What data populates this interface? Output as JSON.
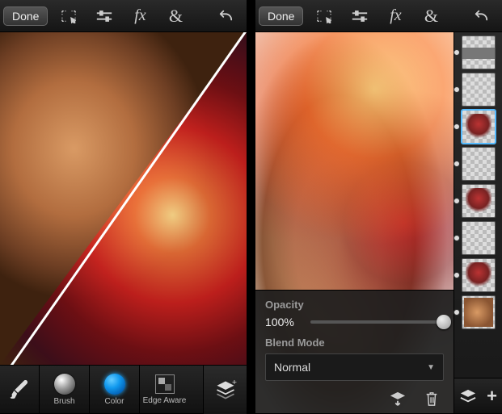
{
  "toolbar": {
    "done": "Done"
  },
  "bottom": {
    "brush": "Brush",
    "color": "Color",
    "edge": "Edge Aware"
  },
  "layerPanel": {
    "opacity_label": "Opacity",
    "opacity_value": "100%",
    "blend_label": "Blend Mode",
    "blend_value": "Normal"
  }
}
